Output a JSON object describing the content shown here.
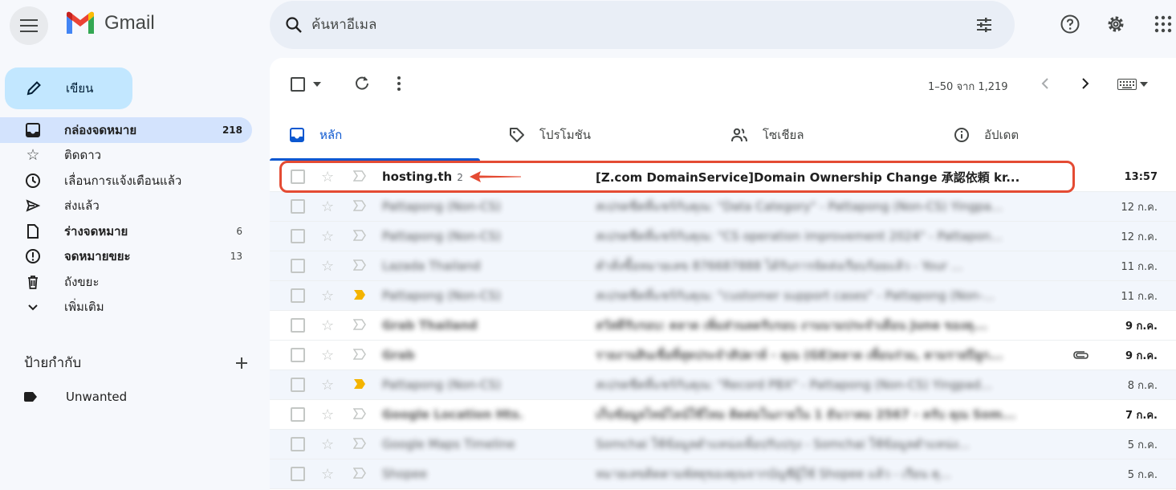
{
  "app": {
    "name": "Gmail"
  },
  "search": {
    "placeholder": "ค้นหาอีเมล"
  },
  "compose": {
    "label": "เขียน"
  },
  "nav": [
    {
      "icon": "inbox-icon",
      "label": "กล่องจดหมาย",
      "count": "218",
      "active": true,
      "bold": true
    },
    {
      "icon": "star-icon",
      "label": "ติดดาว",
      "count": ""
    },
    {
      "icon": "clock-icon",
      "label": "เลื่อนการแจ้งเตือนแล้ว",
      "count": ""
    },
    {
      "icon": "send-icon",
      "label": "ส่งแล้ว",
      "count": ""
    },
    {
      "icon": "draft-icon",
      "label": "ร่างจดหมาย",
      "count": "6",
      "bold": true
    },
    {
      "icon": "spam-icon",
      "label": "จดหมายขยะ",
      "count": "13",
      "bold": true
    },
    {
      "icon": "trash-icon",
      "label": "ถังขยะ",
      "count": ""
    },
    {
      "icon": "chevron-down-icon",
      "label": "เพิ่มเติม",
      "count": ""
    }
  ],
  "labels": {
    "title": "ป้ายกำกับ",
    "items": [
      {
        "name": "Unwanted"
      }
    ]
  },
  "toolbar": {
    "pager": "1–50 จาก 1,219"
  },
  "tabs": [
    {
      "label": "หลัก",
      "icon": "inbox-icon",
      "active": true
    },
    {
      "label": "โปรโมชัน",
      "icon": "tag-icon"
    },
    {
      "label": "โซเชียล",
      "icon": "people-icon"
    },
    {
      "label": "อัปเดต",
      "icon": "info-icon"
    }
  ],
  "emails": [
    {
      "sender": "hosting.th",
      "count": "2",
      "subject": "[Z.com DomainService]Domain Ownership Change 承認依頼 kr...",
      "date": "13:57",
      "unread": true,
      "blurred": false,
      "important": false
    },
    {
      "sender": "Pattapong (Non-CS)",
      "subject": "สเปรดชีตที่แชร์กับคุณ: \"Data Category\" - Pattapong (Non-CS) Yingpa...",
      "date": "12 ก.ค.",
      "unread": false,
      "blurred": true,
      "important": false
    },
    {
      "sender": "Pattapong (Non-CS)",
      "subject": "สเปรดชีตที่แชร์กับคุณ: \"CS operation improvement 2024\" - Pattapon...",
      "date": "12 ก.ค.",
      "unread": false,
      "blurred": true,
      "important": false
    },
    {
      "sender": "Lazada Thailand",
      "subject": "คำสั่งซื้อหมายเลข 876687888 ได้รับการจัดส่งเรียบร้อยแล้ว - Your ...",
      "date": "11 ก.ค.",
      "unread": false,
      "blurred": true,
      "important": false
    },
    {
      "sender": "Pattapong (Non-CS)",
      "subject": "สเปรดชีตที่แชร์กับคุณ: \"customer support cases\" - Pattapong (Non-...",
      "date": "11 ก.ค.",
      "unread": false,
      "blurred": true,
      "important": true
    },
    {
      "sender": "Grab Thailand",
      "subject": "สวัสดีรับรอบ: ตลาด เพิ่มส่วนลดรับรอบ งานนามประจำเดือน June ของคุ...",
      "date": "9 ก.ค.",
      "unread": true,
      "blurred": true,
      "important": false
    },
    {
      "sender": "Grab",
      "subject": "รายงานสินเชื่อที่สุดประจำสัปดาห์ - คุณ (GE)ตลาด เพื่อนร่วม, ตามรายปีลูก...",
      "date": "9 ก.ค.",
      "unread": true,
      "blurred": true,
      "important": false,
      "attachment": true
    },
    {
      "sender": "Pattapong (Non-CS)",
      "subject": "สเปรดชีตที่แชร์กับคุณ: \"Record PBX\" - Pattapong (Non-CS) Yingpad...",
      "date": "8 ก.ค.",
      "unread": false,
      "blurred": true,
      "important": true
    },
    {
      "sender": "Google Location Hts.",
      "subject": "เก็บข้อมูลไทม์ไลน์ใช้ไหม ติดต่อในภายใน 1 ธันวาคม 2567 - ครับ คุณ Som...",
      "date": "7 ก.ค.",
      "unread": true,
      "blurred": true,
      "important": false
    },
    {
      "sender": "Google Maps Timeline",
      "subject": "Somchai ใช้ข้อมูลตำแหน่งเพื่อปรับปรุง - Somchai ใช้ข้อมูลตำแหน่ง...",
      "date": "5 ก.ค.",
      "unread": false,
      "blurred": true,
      "important": false
    },
    {
      "sender": "Shopee",
      "subject": "หมายเลขติดตามพัสดุของคุณจากบัญชีผู้ใช้ Shopee แล้ว - เรียน คุ...",
      "date": "5 ก.ค.",
      "unread": false,
      "blurred": true,
      "important": false
    }
  ],
  "colors": {
    "accent": "#0b57d0",
    "compose_bg": "#c2e7ff",
    "highlight": "#e44b33",
    "important": "#f4b400"
  }
}
